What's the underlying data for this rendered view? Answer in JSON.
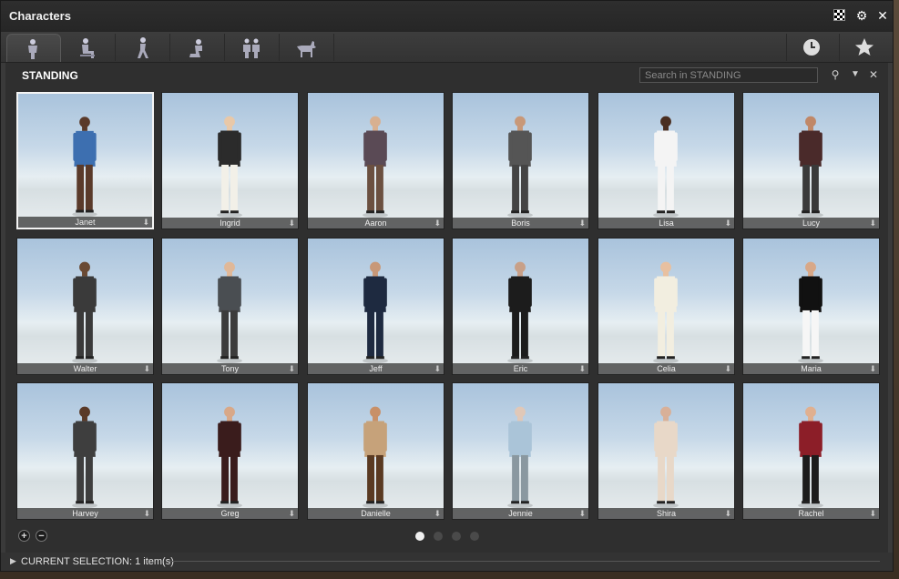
{
  "window": {
    "title": "Characters"
  },
  "tabs": [
    {
      "name": "tab-standing",
      "icon": "standing-person-icon",
      "active": true
    },
    {
      "name": "tab-sitting",
      "icon": "sitting-person-icon",
      "active": false
    },
    {
      "name": "tab-walking",
      "icon": "walking-person-icon",
      "active": false
    },
    {
      "name": "tab-kneeling",
      "icon": "kneeling-person-icon",
      "active": false
    },
    {
      "name": "tab-groups",
      "icon": "group-people-icon",
      "active": false
    },
    {
      "name": "tab-animals",
      "icon": "dog-icon",
      "active": false
    }
  ],
  "right_tabs": [
    {
      "name": "tab-recent",
      "icon": "clock-icon"
    },
    {
      "name": "tab-favorites",
      "icon": "star-icon"
    }
  ],
  "section": {
    "title": "STANDING",
    "search_placeholder": "Search in STANDING"
  },
  "characters": [
    {
      "name": "Janet",
      "selected": true
    },
    {
      "name": "Ingrid"
    },
    {
      "name": "Aaron"
    },
    {
      "name": "Boris"
    },
    {
      "name": "Lisa"
    },
    {
      "name": "Lucy"
    },
    {
      "name": "Walter"
    },
    {
      "name": "Tony"
    },
    {
      "name": "Jeff"
    },
    {
      "name": "Eric"
    },
    {
      "name": "Celia"
    },
    {
      "name": "Maria"
    },
    {
      "name": "Harvey"
    },
    {
      "name": "Greg"
    },
    {
      "name": "Danielle"
    },
    {
      "name": "Jennie"
    },
    {
      "name": "Shira"
    },
    {
      "name": "Rachel"
    }
  ],
  "pager": {
    "pages": 4,
    "current": 1
  },
  "status": {
    "text": "CURRENT SELECTION: 1 item(s)"
  },
  "colors": {
    "panel": "#3a3a3a",
    "accent": "#f0f0f0"
  }
}
